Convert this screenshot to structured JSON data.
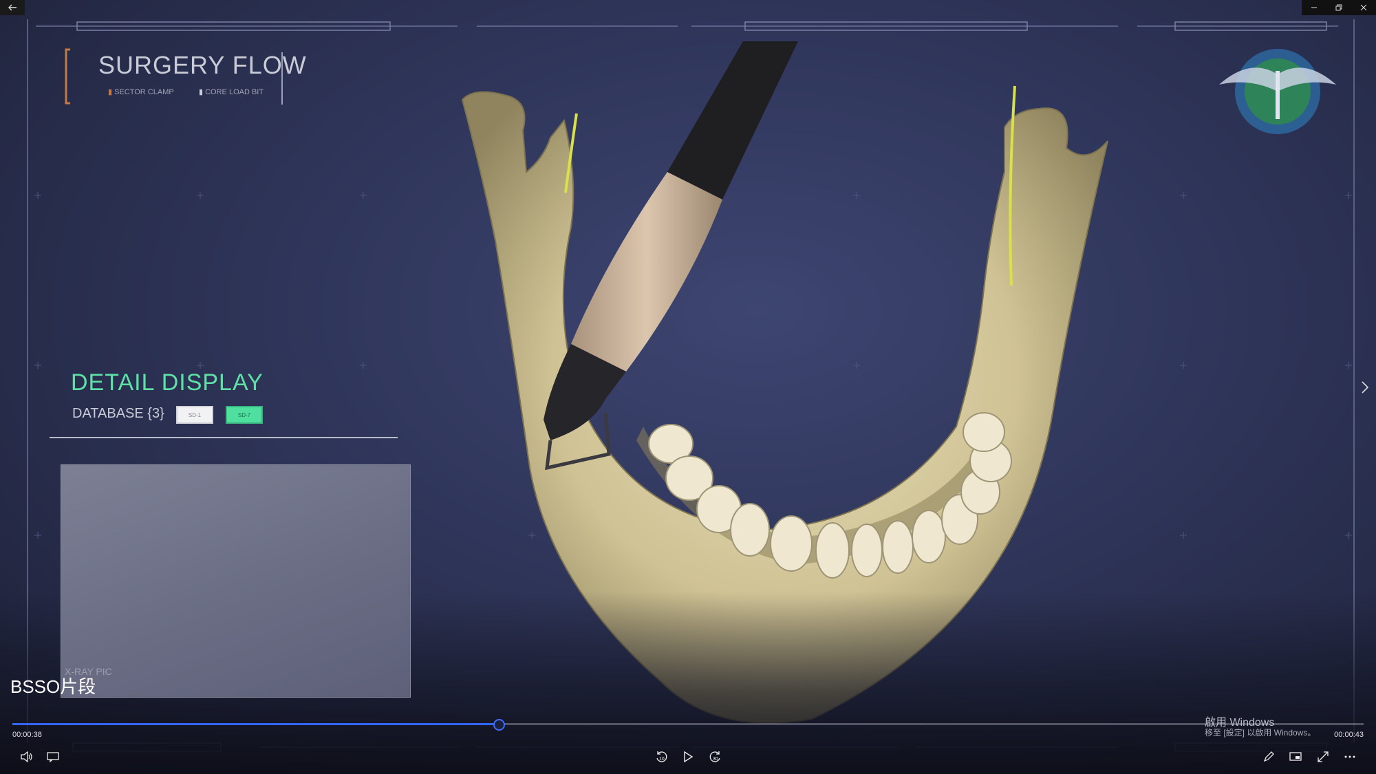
{
  "window": {
    "back_icon": "back-arrow-icon",
    "controls": [
      "minimize-icon",
      "restore-icon",
      "close-icon"
    ]
  },
  "overlay": {
    "surgery_title": "SURGERY FLOW",
    "surgery_items": [
      "SECTOR CLAMP",
      "CORE LOAD BIT"
    ],
    "detail_title": "DETAIL DISPLAY",
    "database_label": "DATABASE {3}",
    "chips": [
      "SD-1",
      "SD-7"
    ],
    "xray_label": "X-RAY PIC",
    "accent_color": "#5fe0a6"
  },
  "player": {
    "clip_title": "BSSO片段",
    "elapsed": "00:00:38",
    "remaining": "00:00:43",
    "progress_fraction": 0.36,
    "accent_color": "#3366ff",
    "left_controls": [
      "volume-icon",
      "subtitles-icon"
    ],
    "center_controls": [
      "skip-back-10-icon",
      "play-icon",
      "skip-forward-30-icon"
    ],
    "right_controls": [
      "pen-icon",
      "miniplayer-icon",
      "fullscreen-icon",
      "more-icon"
    ]
  },
  "watermark": {
    "line1": "啟用 Windows",
    "line2": "移至 [設定] 以啟用 Windows。"
  }
}
